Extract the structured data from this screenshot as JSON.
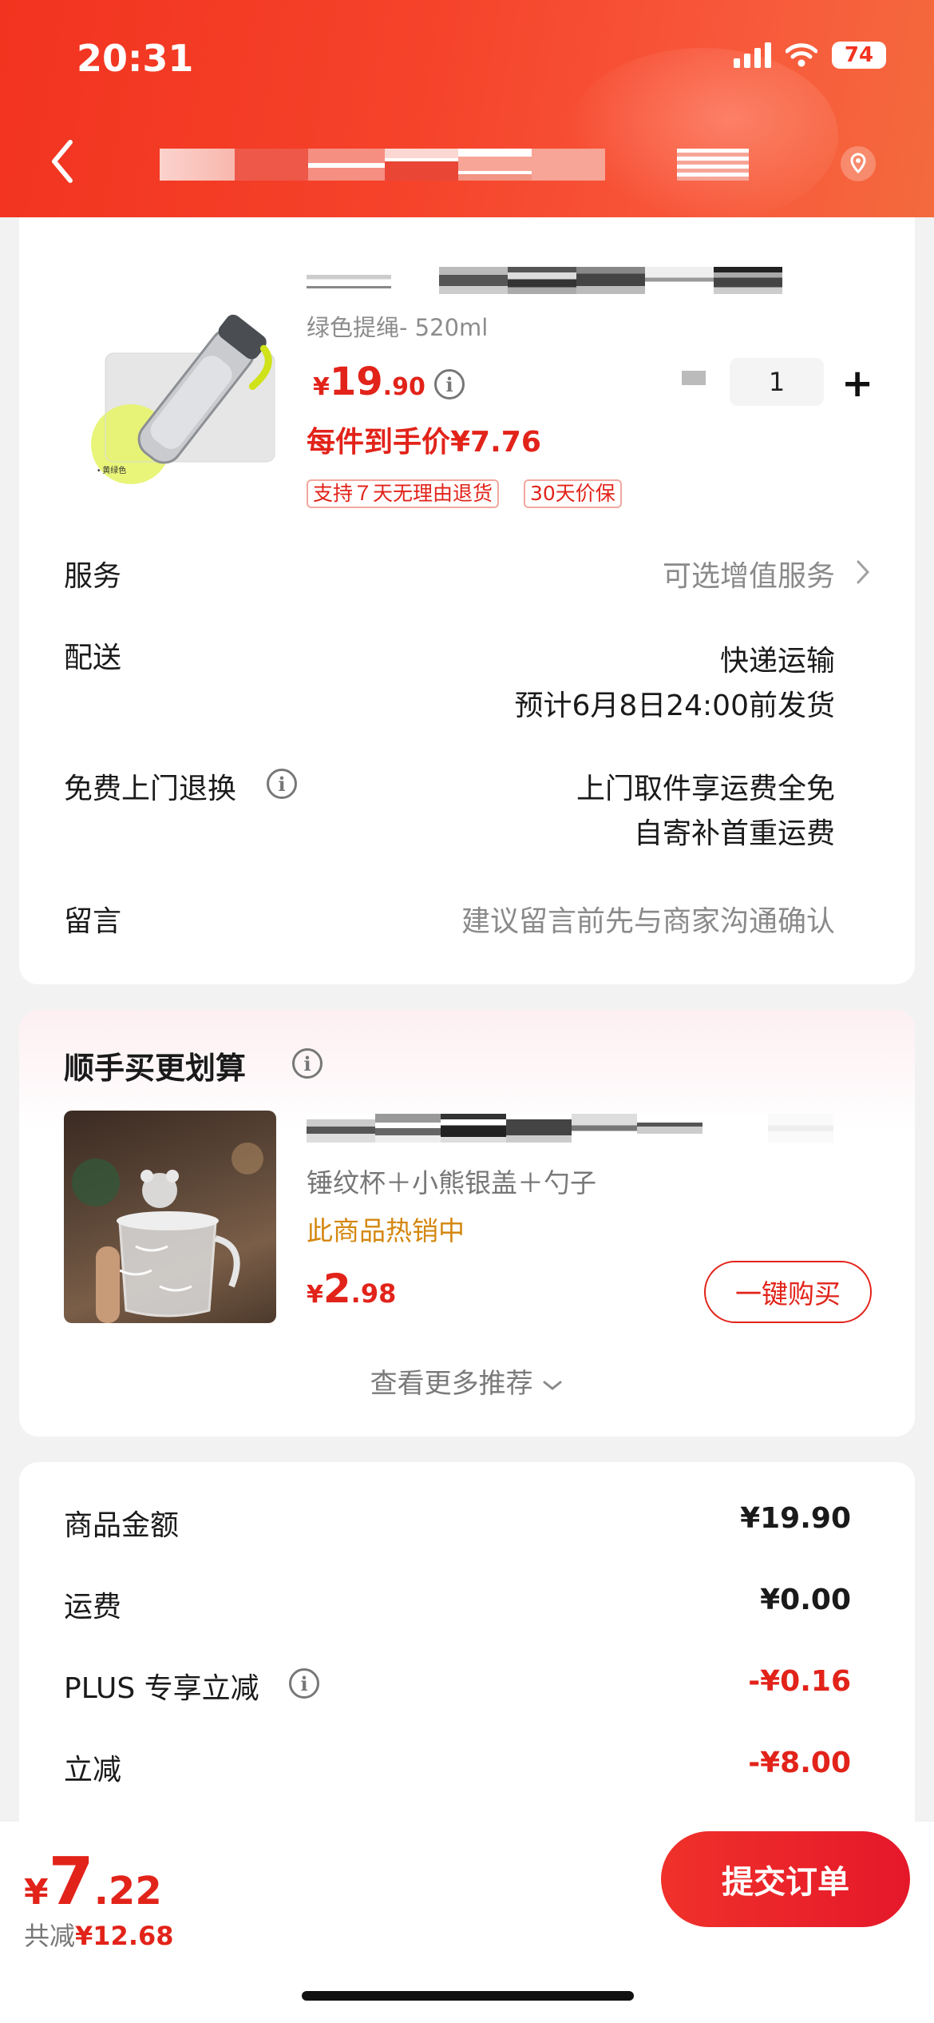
{
  "status": {
    "time": "20:31",
    "battery": "74"
  },
  "product": {
    "variant": "绿色提绳- 520ml",
    "price_yen": "¥",
    "price_int": "19",
    "price_dec": ".90",
    "quantity": "1",
    "net_price": "每件到手价¥7.76",
    "tags": [
      "支持７天无理由退货",
      "30天价保"
    ]
  },
  "rows": {
    "service_label": "服务",
    "service_value": "可选增值服务",
    "delivery_label": "配送",
    "delivery_value1": "快递运输",
    "delivery_value2": "预计6月8日24:00前发货",
    "return_label": "免费上门退换",
    "return_value1": "上门取件享运费全免",
    "return_value2": "自寄补首重运费",
    "note_label": "留言",
    "note_placeholder": "建议留言前先与商家沟通确认"
  },
  "recommend": {
    "title": "顺手买更划算",
    "item_sub": "锤纹杯＋小熊银盖＋勺子",
    "hot": "此商品热销中",
    "price_yen": "¥",
    "price_int": "2",
    "price_dec": ".98",
    "buy_label": "一键购买",
    "more_label": "查看更多推荐"
  },
  "summary": [
    {
      "label": "商品金额",
      "value": "¥19.90",
      "red": false
    },
    {
      "label": "运费",
      "value": "¥0.00",
      "red": false
    },
    {
      "label": "PLUS 专享立减",
      "value": "-¥0.16",
      "red": true
    },
    {
      "label": "立减",
      "value": "-¥8.00",
      "red": true
    }
  ],
  "bottom": {
    "total_yen": "¥",
    "total_int": "7",
    "total_dec": ".22",
    "saved_prefix": "共减",
    "saved_value": "¥12.68",
    "submit_label": "提交订单"
  },
  "colors": {
    "brand_red": "#e2231a",
    "header_start": "#f2331f",
    "hot_orange": "#d4870f"
  },
  "icons": [
    "back-icon",
    "location-icon",
    "info-icon",
    "chevron-right-icon",
    "chevron-down-icon",
    "signal-icon",
    "wifi-icon",
    "battery-icon"
  ]
}
